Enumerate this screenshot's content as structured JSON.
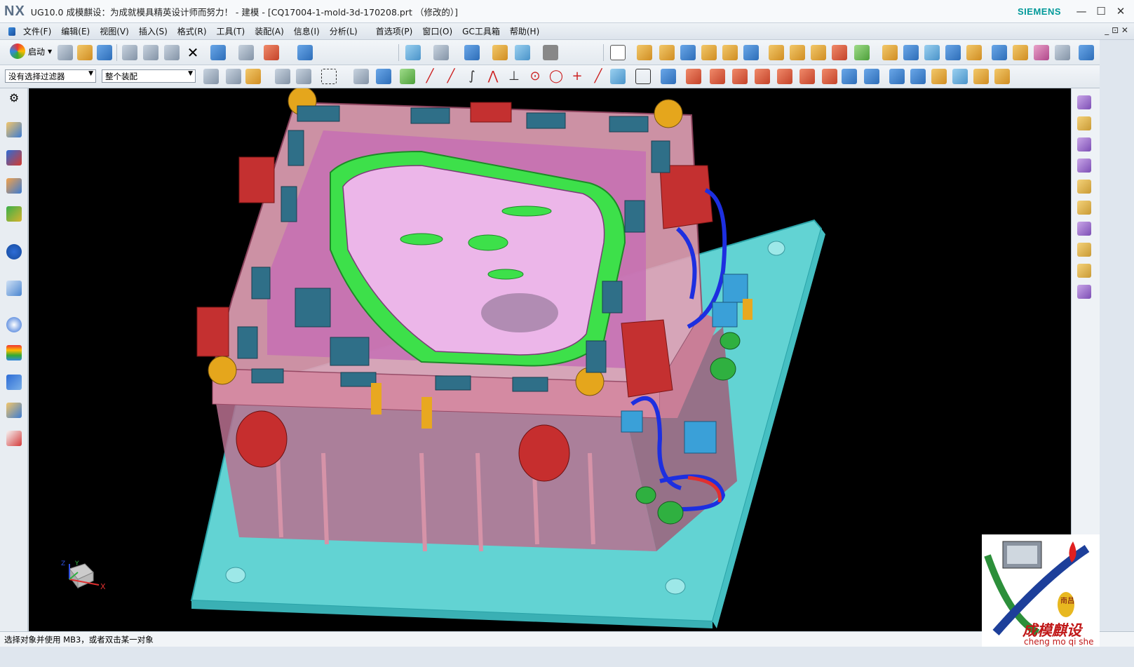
{
  "titlebar": {
    "logo": "NX",
    "title": "UG10.0  成模麒设：为成就模具精英设计师而努力！ - 建模 - [CQ17004-1-mold-3d-170208.prt （修改的）]",
    "brand": "SIEMENS",
    "minimize": "—",
    "maximize": "☐",
    "close": "✕"
  },
  "menubar": {
    "items": [
      "文件(F)",
      "编辑(E)",
      "视图(V)",
      "插入(S)",
      "格式(R)",
      "工具(T)",
      "装配(A)",
      "信息(I)",
      "分析(L)",
      "首选项(P)",
      "窗口(O)",
      "GC工具箱",
      "帮助(H)"
    ],
    "window_controls": "_ ⊡ ✕"
  },
  "toolbar": {
    "start_label": "启动",
    "filter_select": "没有选择过滤器",
    "scope_select": "整个装配"
  },
  "status": {
    "message": "选择对象并使用 MB3，或者双击某一对象"
  },
  "triad": {
    "x": "X",
    "y": "Y",
    "z": "Z"
  },
  "watermark": {
    "chinese": "成模麒设",
    "pinyin": "cheng mo qi she",
    "seal": "南昌"
  },
  "colors": {
    "viewport_bg": "#000000",
    "plate": "#5fd0d0",
    "mold_body": "#d98aa6",
    "part": "#e9b8e6",
    "runner": "#39e04a"
  }
}
